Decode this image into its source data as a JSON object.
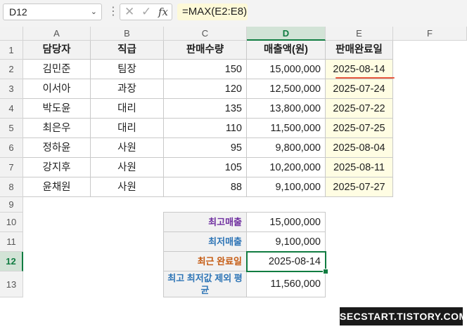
{
  "formula_bar": {
    "name_box": "D12",
    "name_box_arrow": "⌄",
    "separator": "⋮",
    "cancel_glyph": "✕",
    "confirm_glyph": "✓",
    "fx_label": "fx",
    "formula": "=MAX(E2:E8)"
  },
  "grid": {
    "columns": [
      "A",
      "B",
      "C",
      "D",
      "E",
      "F"
    ],
    "rows": [
      "1",
      "2",
      "3",
      "4",
      "5",
      "6",
      "7",
      "8",
      "9",
      "10",
      "11",
      "12",
      "13"
    ],
    "active_cell": "D12"
  },
  "table": {
    "headers": [
      "담당자",
      "직급",
      "판매수량",
      "매출액(원)",
      "판매완료일"
    ],
    "rows": [
      [
        "김민준",
        "팀장",
        "150",
        "15,000,000",
        "2025-08-14"
      ],
      [
        "이서아",
        "과장",
        "120",
        "12,500,000",
        "2025-07-24"
      ],
      [
        "박도윤",
        "대리",
        "135",
        "13,800,000",
        "2025-07-22"
      ],
      [
        "최은우",
        "대리",
        "110",
        "11,500,000",
        "2025-07-25"
      ],
      [
        "정하윤",
        "사원",
        "95",
        "9,800,000",
        "2025-08-04"
      ],
      [
        "강지후",
        "사원",
        "105",
        "10,200,000",
        "2025-08-11"
      ],
      [
        "윤채원",
        "사원",
        "88",
        "9,100,000",
        "2025-07-27"
      ]
    ]
  },
  "summary": [
    {
      "label": "최고매출",
      "value": "15,000,000",
      "color": "#7030a0"
    },
    {
      "label": "최저매출",
      "value": "9,100,000",
      "color": "#2e75b6"
    },
    {
      "label": "최근 완료일",
      "value": "2025-08-14",
      "color": "#c55a11"
    },
    {
      "label": "최고 최저값 제외 평균",
      "value": "11,560,000",
      "color": "#2e75b6"
    }
  ],
  "colors": {
    "accent": "#107c41",
    "underline": "#e8583e",
    "highlight": "#fffde3"
  },
  "watermark": "SECSTART.TISTORY.COM"
}
